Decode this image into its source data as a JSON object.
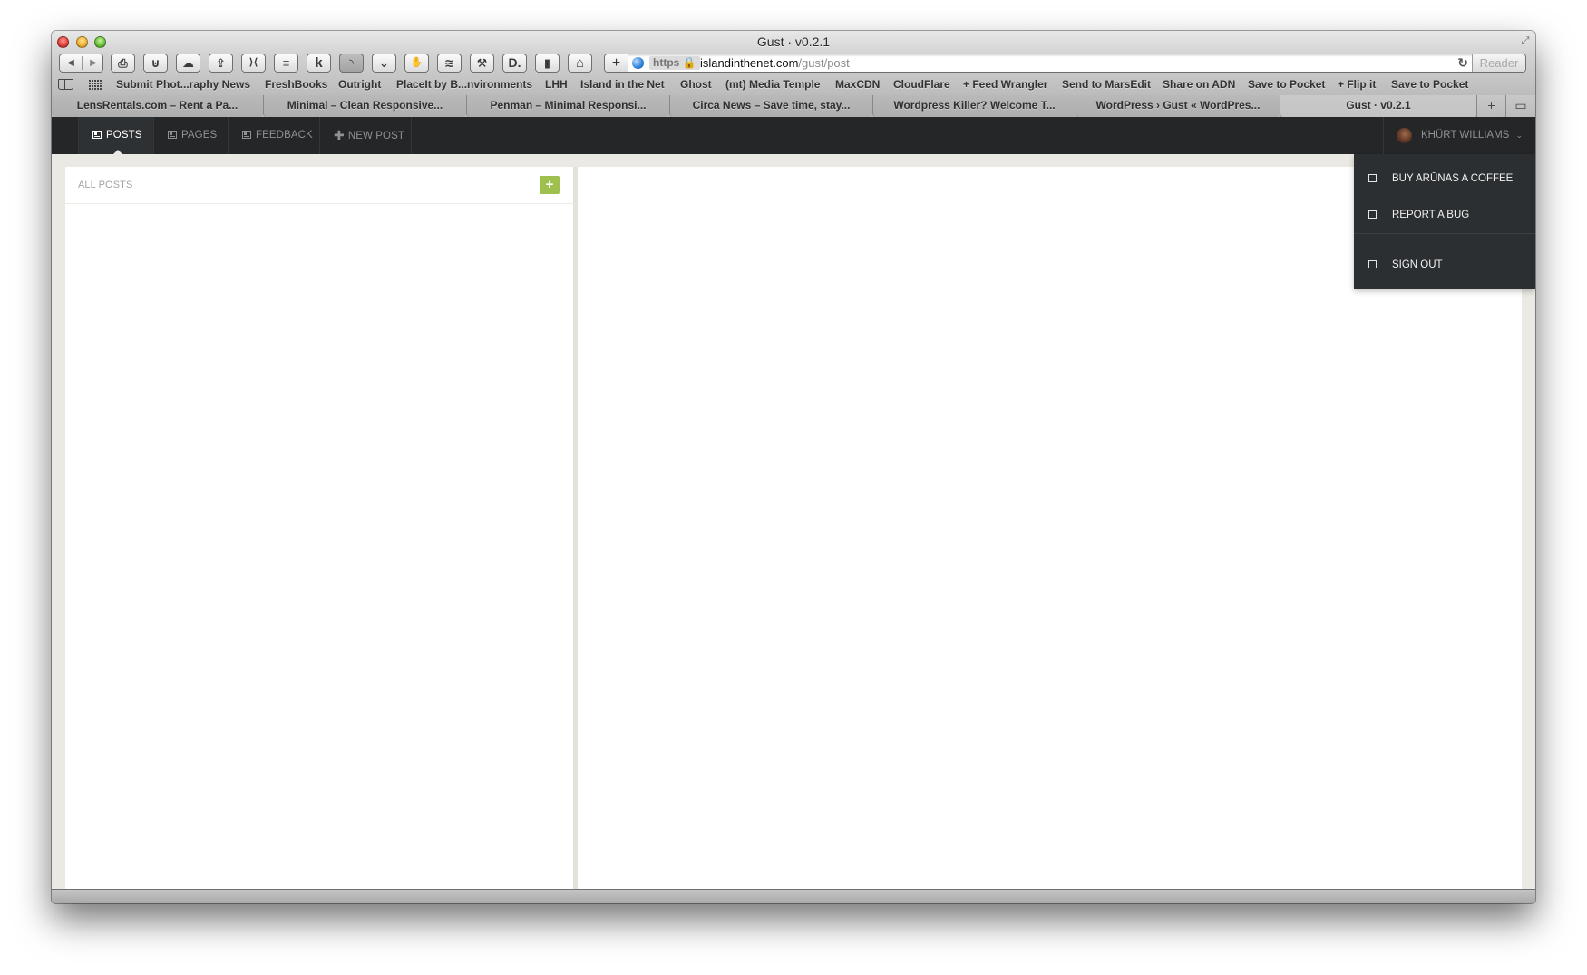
{
  "window": {
    "title": "Gust · v0.2.1",
    "fullscreen_icon": "⤢"
  },
  "toolbar": {
    "back_icon": "◀",
    "forward_icon": "▶",
    "extension_buttons": [
      {
        "name": "print-icon",
        "glyph": "⎙"
      },
      {
        "name": "instapaper-icon",
        "glyph": "⊎"
      },
      {
        "name": "icloud-icon",
        "glyph": "☁"
      },
      {
        "name": "share-icon",
        "glyph": "⇪"
      },
      {
        "name": "readability-icon",
        "glyph": "⟩⟨"
      },
      {
        "name": "reader-list-icon",
        "glyph": "≡"
      },
      {
        "name": "klout-icon",
        "glyph": "k"
      },
      {
        "name": "rss-icon",
        "glyph": "◝"
      },
      {
        "name": "pocket-icon",
        "glyph": "⌄"
      },
      {
        "name": "evernote-icon",
        "glyph": "✋"
      },
      {
        "name": "buffer-icon",
        "glyph": "≋"
      },
      {
        "name": "hammer-icon",
        "glyph": "⚒"
      },
      {
        "name": "d-icon",
        "glyph": "D."
      },
      {
        "name": "bookmarklet-icon",
        "glyph": "▮"
      },
      {
        "name": "home-icon",
        "glyph": "⌂"
      }
    ],
    "address_bar": {
      "add_icon": "+",
      "https_label": "https 🔒",
      "domain": "islandinthenet.com",
      "path": "/gust/post",
      "reload_icon": "↻",
      "reader_label": "Reader"
    }
  },
  "bookmarks": [
    "Submit Phot...raphy News",
    "FreshBooks",
    "Outright",
    "PlaceIt by B...nvironments",
    "LHH",
    "Island in the Net",
    "Ghost",
    "(mt) Media Temple",
    "MaxCDN",
    "CloudFlare",
    "+ Feed Wrangler",
    "Send to MarsEdit",
    "Share on ADN",
    "Save to Pocket",
    "+ Flip it",
    "Save to Pocket"
  ],
  "tabs": [
    {
      "label": "LensRentals.com – Rent a Pa...",
      "active": false
    },
    {
      "label": "Minimal – Clean Responsive...",
      "active": false
    },
    {
      "label": "Penman – Minimal Responsi...",
      "active": false
    },
    {
      "label": "Circa News – Save time, stay...",
      "active": false
    },
    {
      "label": "Wordpress Killer? Welcome T...",
      "active": false
    },
    {
      "label": "WordPress › Gust « WordPres...",
      "active": false
    },
    {
      "label": "Gust · v0.2.1",
      "active": true
    }
  ],
  "tab_controls": {
    "new_tab_icon": "+",
    "tab_overview_icon": "▭"
  },
  "app_nav": {
    "items": [
      {
        "label": "POSTS",
        "icon": "posts-icon",
        "active": true
      },
      {
        "label": "PAGES",
        "icon": "pages-icon",
        "active": false
      },
      {
        "label": "FEEDBACK",
        "icon": "feedback-icon",
        "active": false
      },
      {
        "label": "NEW POST",
        "icon": "plus-icon",
        "active": false
      }
    ],
    "plus_glyph": "✚",
    "user": {
      "name": "KHÜRT WILLIAMS",
      "chevron": "⌄"
    }
  },
  "user_dropdown": {
    "items": [
      {
        "label": "BUY ARŪNAS A COFFEE"
      },
      {
        "label": "REPORT A BUG"
      },
      {
        "label": "SIGN OUT"
      }
    ]
  },
  "list_panel": {
    "title": "ALL POSTS",
    "add_button_label": "+"
  }
}
